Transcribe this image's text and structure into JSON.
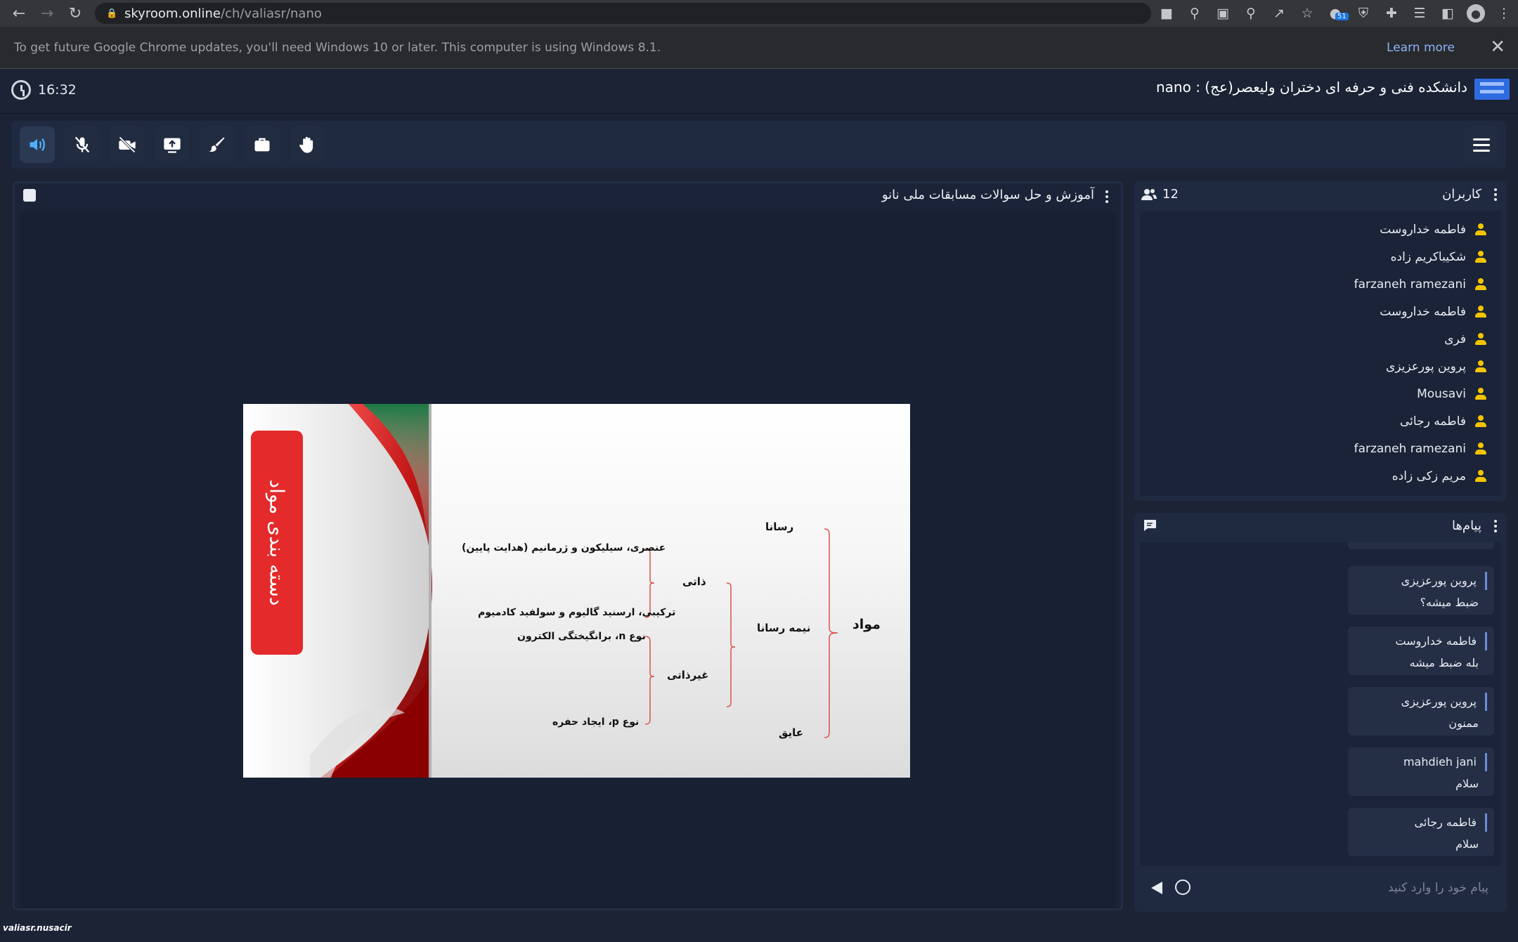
{
  "browser": {
    "url_host": "skyroom.online",
    "url_path": "/ch/valiasr/nano",
    "badge_count": "51"
  },
  "infobar": {
    "message": "To get future Google Chrome updates, you'll need Windows 10 or later. This computer is using Windows 8.1.",
    "learn_more": "Learn more",
    "close": "✕"
  },
  "header": {
    "time": "16:32",
    "room_title": "دانشکده فنی و حرفه ای دختران ولیعصر(عج) : nano"
  },
  "presentation": {
    "title": "آموزش و حل سوالات مسابقات ملی نانو",
    "slide": {
      "side_title": "دسته بندی مواد",
      "root": "مواد",
      "conductor": "رسانا",
      "semiconductor": "نیمه رسانا",
      "insulator": "عایق",
      "intrinsic": "ذاتی",
      "extrinsic": "غیرذاتی",
      "elemental": "عنصری، سیلیکون و ژرمانیم (هدایت پایین)",
      "compound": "ترکیبی، ارسنید گالیوم و سولفید کادمیوم",
      "n_type": "نوع  n، برانگیختگی الکترون",
      "p_type": "نوع  p، ایجاد حفره"
    }
  },
  "users": {
    "title": "کاربران",
    "count": "12",
    "list": [
      "فاطمه خداروست",
      "شکیباکریم زاده",
      "farzaneh ramezani",
      "فاطمه خداروست",
      "فری",
      "پروین پورعزیزی",
      "Mousavi",
      "فاطمه رجائی",
      "farzaneh ramezani",
      "مریم زکی زاده"
    ]
  },
  "chat": {
    "title": "پیام‌ها",
    "messages": [
      {
        "sender": "پروین پورعزیزی",
        "text": "ضبط میشه؟"
      },
      {
        "sender": "فاطمه خداروست",
        "text": "بله ضبط میشه"
      },
      {
        "sender": "پروین پورعزیزی",
        "text": "ممنون"
      },
      {
        "sender": "mahdieh jani",
        "text": "سلام"
      },
      {
        "sender": "فاطمه رجائی",
        "text": "سلام"
      }
    ],
    "input_placeholder": "پیام خود را وارد کنید"
  },
  "footer": {
    "watermark": "valiasr.nusacir"
  },
  "colors": {
    "accent": "#4fb0ff",
    "user_icon": "#f4c400",
    "slide_red": "#e42a2a"
  }
}
